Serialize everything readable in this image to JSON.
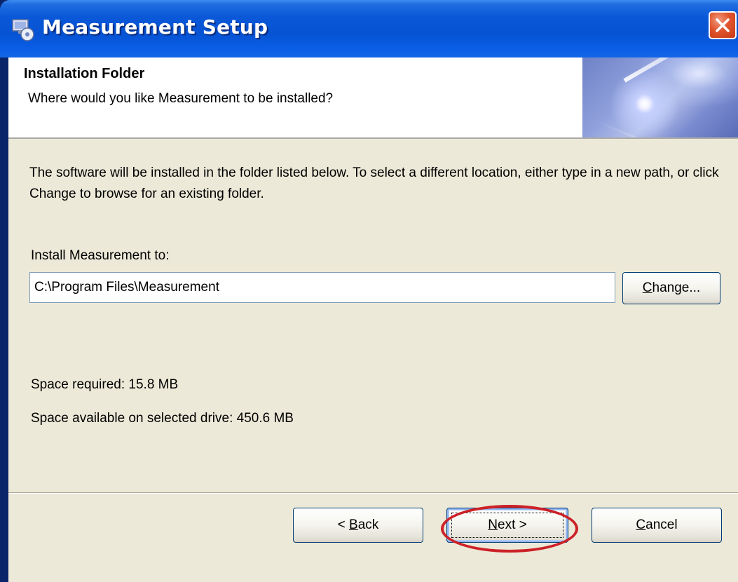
{
  "window": {
    "title": "Measurement Setup",
    "title_bar_color": "#0a58d8"
  },
  "header": {
    "title": "Installation Folder",
    "subtitle": "Where would you like Measurement to be installed?"
  },
  "body": {
    "description": "The software will be installed in the folder listed below. To select a different location, either type in a new path, or click Change to browse for an existing folder.",
    "install_label": "Install Measurement to:",
    "install_path": "C:\\Program Files\\Measurement",
    "change_button": {
      "mnemonic": "C",
      "rest": "hange..."
    },
    "space_required": "Space required: 15.8 MB",
    "space_available": "Space available on selected drive: 450.6 MB"
  },
  "footer": {
    "back_button": {
      "prefix": "< ",
      "mnemonic": "B",
      "rest": "ack"
    },
    "next_button": {
      "mnemonic": "N",
      "rest": "ext >"
    },
    "cancel_button": {
      "mnemonic": "C",
      "rest": "ancel"
    }
  },
  "annotation": {
    "highlight_color": "#cc2127"
  }
}
